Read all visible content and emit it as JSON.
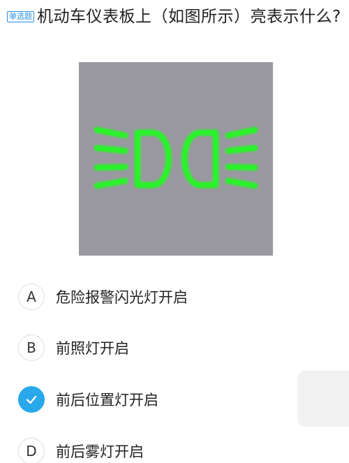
{
  "question": {
    "badge": "单选题",
    "text": "机动车仪表板上（如图所示）亮表示什么?"
  },
  "figure": {
    "icon": "position-lights-icon",
    "background_color": "#9a98a0",
    "symbol_color": "#2cf22a"
  },
  "options": [
    {
      "letter": "A",
      "text": "危险报警闪光灯开启",
      "selected": false
    },
    {
      "letter": "B",
      "text": "前照灯开启",
      "selected": false
    },
    {
      "letter": "",
      "text": "前后位置灯开启",
      "selected": true
    },
    {
      "letter": "D",
      "text": "前后雾灯开启",
      "selected": false
    }
  ],
  "colors": {
    "accent": "#29a8ec",
    "badge": "#2b8fe6"
  }
}
